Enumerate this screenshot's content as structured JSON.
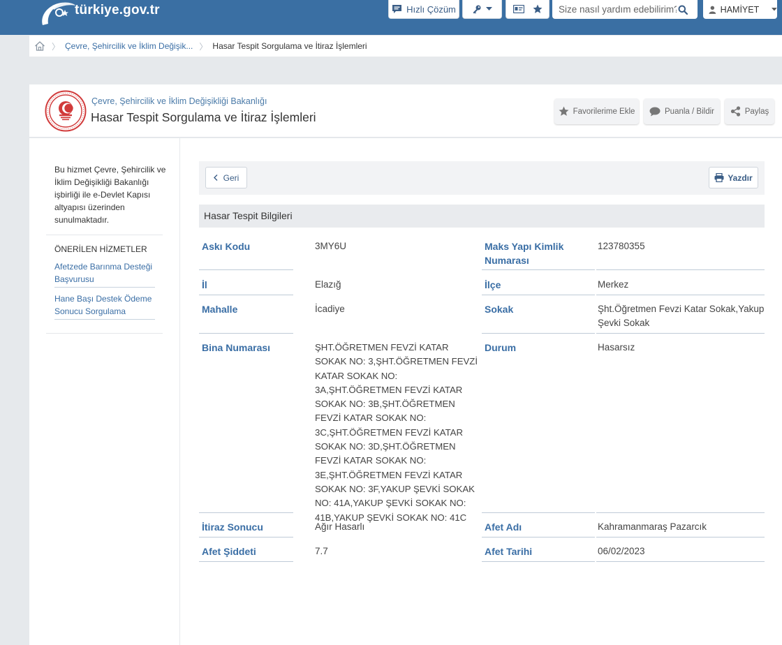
{
  "topbar": {
    "logo_text": "türkiye.gov.tr",
    "quick_solution_label": "Hızlı Çözüm",
    "search_placeholder": "Size nasıl yardım edebilirim?",
    "user_name": "HAMİYET"
  },
  "breadcrumb": {
    "items": [
      "Çevre, Şehircilik ve İklim Değişik...",
      "Hasar Tespit Sorgulama ve İtiraz İşlemleri"
    ]
  },
  "service_header": {
    "organization": "Çevre, Şehircilik ve İklim Değişikliği Bakanlığı",
    "title": "Hasar Tespit Sorgulama ve İtiraz İşlemleri",
    "favorites_label": "Favorilerime Ekle",
    "rate_label": "Puanla / Bildir",
    "share_label": "Paylaş"
  },
  "sidebar": {
    "description": "Bu hizmet Çevre, Şehircilik ve İklim Değişikliği Bakanlığı işbirliği ile e-Devlet Kapısı altyapısı üzerinden sunulmaktadır.",
    "recommended_heading": "ÖNERİLEN HİZMETLER",
    "recommended": [
      "Afetzede Barınma Desteği Başvurusu",
      "Hane Başı Destek Ödeme Sonucu Sorgulama"
    ]
  },
  "main": {
    "back_label": "Geri",
    "print_label": "Yazdır",
    "section_title": "Hasar Tespit Bilgileri",
    "fields": {
      "aski_kodu": {
        "label": "Askı Kodu",
        "value": "3MY6U"
      },
      "maks_yapi": {
        "label": "Maks Yapı Kimlik Numarası",
        "value": "123780355"
      },
      "il": {
        "label": "İl",
        "value": "Elazığ"
      },
      "ilce": {
        "label": "İlçe",
        "value": "Merkez"
      },
      "mahalle": {
        "label": "Mahalle",
        "value": "İcadiye"
      },
      "sokak": {
        "label": "Sokak",
        "value": "Şht.Öğretmen Fevzi Katar Sokak,Yakup Şevki Sokak"
      },
      "bina_numarasi": {
        "label": "Bina Numarası",
        "value": "ŞHT.ÖĞRETMEN FEVZİ KATAR SOKAK NO: 3,ŞHT.ÖĞRETMEN FEVZİ KATAR SOKAK NO: 3A,ŞHT.ÖĞRETMEN FEVZİ KATAR SOKAK NO: 3B,ŞHT.ÖĞRETMEN FEVZİ KATAR SOKAK NO: 3C,ŞHT.ÖĞRETMEN FEVZİ KATAR SOKAK NO: 3D,ŞHT.ÖĞRETMEN FEVZİ KATAR SOKAK NO: 3E,ŞHT.ÖĞRETMEN FEVZİ KATAR SOKAK NO: 3F,YAKUP ŞEVKİ SOKAK NO: 41A,YAKUP ŞEVKİ SOKAK NO: 41B,YAKUP ŞEVKİ SOKAK NO: 41C"
      },
      "durum": {
        "label": "Durum",
        "value": "Hasarsız"
      },
      "itiraz_sonucu": {
        "label": "İtiraz Sonucu",
        "value": "Ağır Hasarlı"
      },
      "afet_adi": {
        "label": "Afet Adı",
        "value": "Kahramanmaraş Pazarcık"
      },
      "afet_siddeti": {
        "label": "Afet Şiddeti",
        "value": "7.7"
      },
      "afet_tarihi": {
        "label": "Afet Tarihi",
        "value": "06/02/2023"
      }
    }
  },
  "colors": {
    "topbar": "#3a6fa3",
    "label_blue": "#3a6ea5",
    "page_bg": "#e6e9ec",
    "seal_red": "#d13a3a"
  },
  "icons": [
    "home-icon",
    "chat-icon",
    "key-icon",
    "id-card-icon",
    "star-icon",
    "search-icon",
    "user-icon",
    "chevron-down-icon",
    "chevron-left-icon",
    "print-icon",
    "share-icon",
    "seal-icon"
  ]
}
